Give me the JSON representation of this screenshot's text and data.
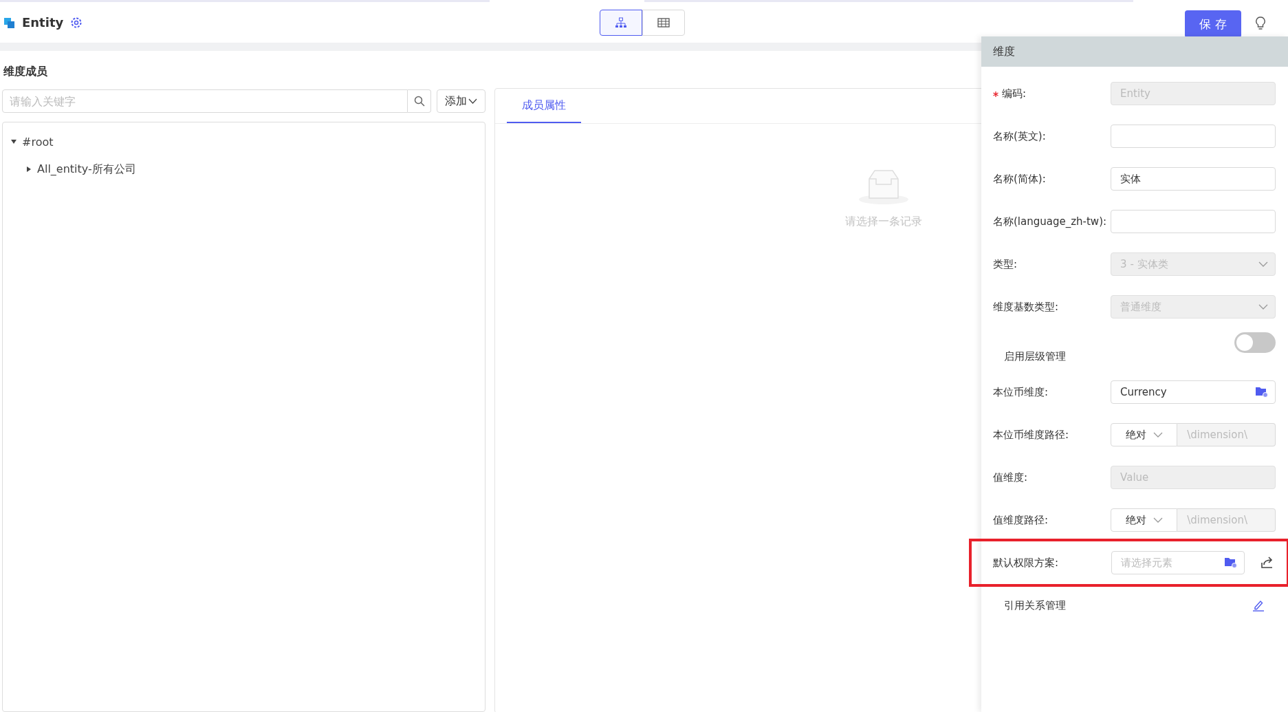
{
  "header": {
    "title": "Entity",
    "views": [
      {
        "kind": "tree",
        "selected": true
      },
      {
        "kind": "table",
        "selected": false
      }
    ],
    "save_button": "保 存"
  },
  "members": {
    "title": "维度成员",
    "search": {
      "placeholder": "请输入关键字"
    },
    "add_button": "添加",
    "tree": [
      {
        "label": "#root",
        "expanded": true,
        "children": [
          {
            "label": "All_entity-所有公司",
            "expanded": false
          }
        ]
      }
    ]
  },
  "detail": {
    "tabs": [
      {
        "label": "成员属性",
        "selected": true
      }
    ],
    "empty_text": "请选择一条记录"
  },
  "drawer": {
    "title": "维度",
    "rows": [
      {
        "kind": "text",
        "label": "编码:",
        "required": true,
        "value": "Entity",
        "disabled": true
      },
      {
        "kind": "text",
        "label": "名称(英文):",
        "required": false,
        "value": "",
        "disabled": false
      },
      {
        "kind": "text",
        "label": "名称(简体):",
        "required": false,
        "value": "实体",
        "disabled": false
      },
      {
        "kind": "text",
        "label": "名称(language_zh-tw):",
        "required": false,
        "value": "",
        "disabled": false
      },
      {
        "kind": "select",
        "label": "类型:",
        "value": "3 - 实体类",
        "disabled": true
      },
      {
        "kind": "select",
        "label": "维度基数类型:",
        "value": "普通维度",
        "disabled": true
      },
      {
        "kind": "toggle",
        "label": "启用层级管理",
        "on": false
      },
      {
        "kind": "picker",
        "label": "本位币维度:",
        "value": "Currency",
        "share_button": false,
        "highlighted": false
      },
      {
        "kind": "path",
        "label": "本位币维度路径:",
        "mode": "绝对",
        "path": "\\dimension\\"
      },
      {
        "kind": "text",
        "label": "值维度:",
        "required": false,
        "value": "Value",
        "disabled": true
      },
      {
        "kind": "path",
        "label": "值维度路径:",
        "mode": "绝对",
        "path": "\\dimension\\"
      },
      {
        "kind": "picker",
        "label": "默认权限方案:",
        "placeholder": "请选择元素",
        "share_button": true,
        "highlighted": true
      },
      {
        "kind": "link",
        "label": "引用关系管理"
      }
    ]
  }
}
